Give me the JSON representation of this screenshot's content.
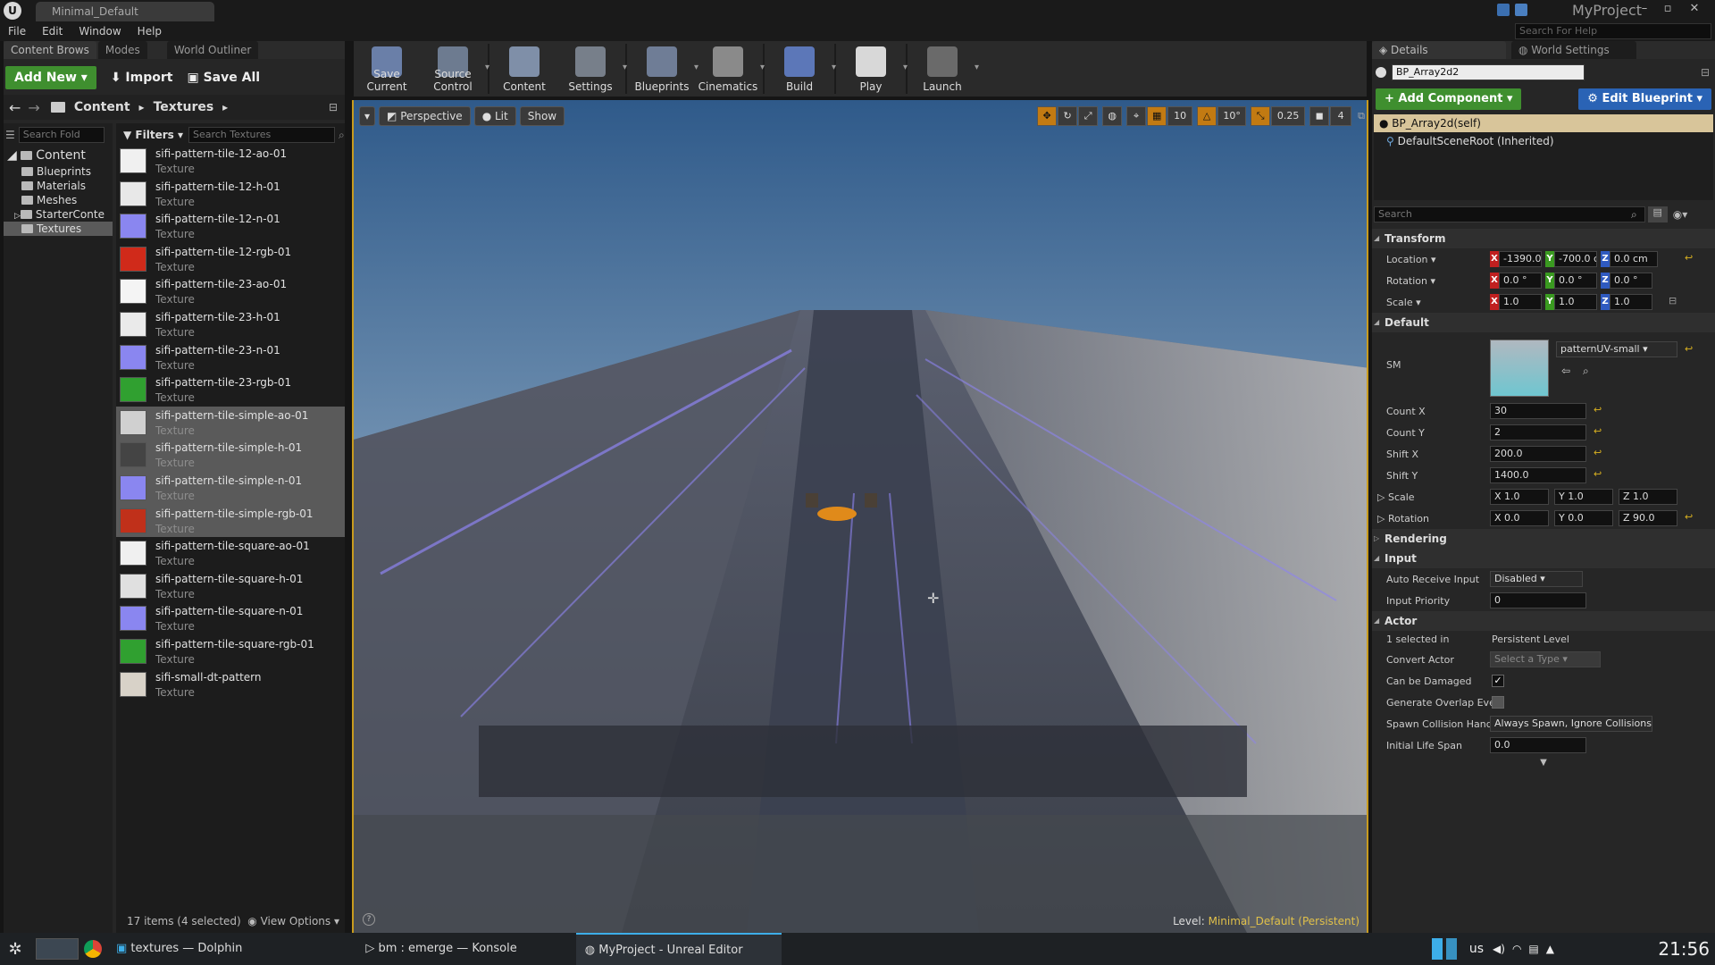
{
  "window": {
    "tab_title": "Minimal_Default",
    "project_name": "MyProject",
    "win_controls": [
      "–",
      "▫",
      "✕"
    ]
  },
  "menu": {
    "items": [
      "File",
      "Edit",
      "Window",
      "Help"
    ],
    "help_search_placeholder": "Search For Help"
  },
  "left_panel": {
    "tabs": [
      "Content Brows",
      "Modes",
      "World Outliner"
    ],
    "add_new_label": "Add New",
    "import_label": "Import",
    "save_all_label": "Save All",
    "path": [
      "Content",
      "Textures"
    ],
    "search_folders_placeholder": "Search Fold",
    "filters_label": "Filters",
    "search_textures_placeholder": "Search Textures",
    "tree": [
      {
        "label": "Content",
        "root": true
      },
      {
        "label": "Blueprints"
      },
      {
        "label": "Materials"
      },
      {
        "label": "Meshes"
      },
      {
        "label": "StarterConte"
      },
      {
        "label": "Textures",
        "selected": true
      }
    ],
    "assets": [
      {
        "name": "sifi-pattern-tile-12-ao-01",
        "type": "Texture",
        "thumb": "#f0f0f0",
        "selected": false
      },
      {
        "name": "sifi-pattern-tile-12-h-01",
        "type": "Texture",
        "thumb": "#e8e8e8",
        "selected": false
      },
      {
        "name": "sifi-pattern-tile-12-n-01",
        "type": "Texture",
        "thumb": "#8a86f0",
        "selected": false
      },
      {
        "name": "sifi-pattern-tile-12-rgb-01",
        "type": "Texture",
        "thumb": "#d02a1a",
        "selected": false
      },
      {
        "name": "sifi-pattern-tile-23-ao-01",
        "type": "Texture",
        "thumb": "#f4f4f4",
        "selected": false
      },
      {
        "name": "sifi-pattern-tile-23-h-01",
        "type": "Texture",
        "thumb": "#eaeaea",
        "selected": false
      },
      {
        "name": "sifi-pattern-tile-23-n-01",
        "type": "Texture",
        "thumb": "#8a86f0",
        "selected": false
      },
      {
        "name": "sifi-pattern-tile-23-rgb-01",
        "type": "Texture",
        "thumb": "#30a030",
        "selected": false
      },
      {
        "name": "sifi-pattern-tile-simple-ao-01",
        "type": "Texture",
        "thumb": "#d0d0d0",
        "selected": true
      },
      {
        "name": "sifi-pattern-tile-simple-h-01",
        "type": "Texture",
        "thumb": "#444444",
        "selected": true
      },
      {
        "name": "sifi-pattern-tile-simple-n-01",
        "type": "Texture",
        "thumb": "#8a86f0",
        "selected": true
      },
      {
        "name": "sifi-pattern-tile-simple-rgb-01",
        "type": "Texture",
        "thumb": "#c0301a",
        "selected": true
      },
      {
        "name": "sifi-pattern-tile-square-ao-01",
        "type": "Texture",
        "thumb": "#f0f0f0",
        "selected": false
      },
      {
        "name": "sifi-pattern-tile-square-h-01",
        "type": "Texture",
        "thumb": "#e0e0e0",
        "selected": false
      },
      {
        "name": "sifi-pattern-tile-square-n-01",
        "type": "Texture",
        "thumb": "#8a86f0",
        "selected": false
      },
      {
        "name": "sifi-pattern-tile-square-rgb-01",
        "type": "Texture",
        "thumb": "#30a030",
        "selected": false
      },
      {
        "name": "sifi-small-dt-pattern",
        "type": "Texture",
        "thumb": "#d8d2c8",
        "selected": false
      }
    ],
    "footer_count": "17 items (4 selected)",
    "view_options_label": "View Options"
  },
  "toolbar": {
    "buttons": [
      {
        "label": "Save Current",
        "icon": "save-icon",
        "color": "#6a7fa8"
      },
      {
        "label": "Source Control",
        "icon": "source-control-icon",
        "color": "#6d7b90"
      },
      {
        "label": "Content",
        "icon": "content-icon",
        "color": "#7f8fa8"
      },
      {
        "label": "Settings",
        "icon": "settings-icon",
        "color": "#777f8a"
      },
      {
        "label": "Blueprints",
        "icon": "blueprints-icon",
        "color": "#6f7d96"
      },
      {
        "label": "Cinematics",
        "icon": "cinematics-icon",
        "color": "#8a8a8a"
      },
      {
        "label": "Build",
        "icon": "build-icon",
        "color": "#5c77b8"
      },
      {
        "label": "Play",
        "icon": "play-icon",
        "color": "#d8d8d8"
      },
      {
        "label": "Launch",
        "icon": "launch-icon",
        "color": "#6a6a6a"
      }
    ]
  },
  "viewport": {
    "perspective_label": "Perspective",
    "lit_label": "Lit",
    "show_label": "Show",
    "grid_snap": "10",
    "rotation_snap": "10°",
    "scale_snap": "0.25",
    "camera_speed": "4",
    "level_label": "Level:",
    "level_name": "Minimal_Default (Persistent)"
  },
  "details": {
    "tabs": [
      "Details",
      "World Settings"
    ],
    "actor_name": "BP_Array2d2",
    "add_component_label": "Add Component",
    "edit_blueprint_label": "Edit Blueprint",
    "components": [
      "BP_Array2d(self)",
      "DefaultSceneRoot (Inherited)"
    ],
    "search_placeholder": "Search",
    "transform": {
      "title": "Transform",
      "location_label": "Location",
      "location": [
        "-1390.0",
        "-700.0 c",
        "0.0 cm"
      ],
      "rotation_label": "Rotation",
      "rotation": [
        "0.0 °",
        "0.0 °",
        "0.0 °"
      ],
      "scale_label": "Scale",
      "scale": [
        "1.0",
        "1.0",
        "1.0"
      ]
    },
    "default": {
      "title": "Default",
      "sm_label": "SM",
      "sm_value": "patternUV-small",
      "count_x_label": "Count X",
      "count_x": "30",
      "count_y_label": "Count Y",
      "count_y": "2",
      "shift_x_label": "Shift X",
      "shift_x": "200.0",
      "shift_y_label": "Shift Y",
      "shift_y": "1400.0",
      "scale_label": "Scale",
      "scale": [
        "X 1.0",
        "Y 1.0",
        "Z 1.0"
      ],
      "rotation_label": "Rotation",
      "rotation": [
        "X 0.0",
        "Y 0.0",
        "Z 90.0"
      ]
    },
    "rendering_title": "Rendering",
    "input": {
      "title": "Input",
      "auto_receive_label": "Auto Receive Input",
      "auto_receive_value": "Disabled",
      "priority_label": "Input Priority",
      "priority_value": "0"
    },
    "actor": {
      "title": "Actor",
      "selected_label": "1 selected in",
      "selected_value": "Persistent Level",
      "convert_label": "Convert Actor",
      "convert_value": "Select a Type",
      "damaged_label": "Can be Damaged",
      "damaged_checked": true,
      "overlap_label": "Generate Overlap Eve",
      "overlap_checked": false,
      "spawn_label": "Spawn Collision Hand",
      "spawn_value": "Always Spawn, Ignore Collisions",
      "lifespan_label": "Initial Life Span",
      "lifespan_value": "0.0"
    }
  },
  "taskbar": {
    "tasks": [
      "textures — Dolphin",
      "bm : emerge — Konsole",
      "MyProject - Unreal Editor"
    ],
    "keyboard_layout": "us",
    "clock": "21:56"
  }
}
